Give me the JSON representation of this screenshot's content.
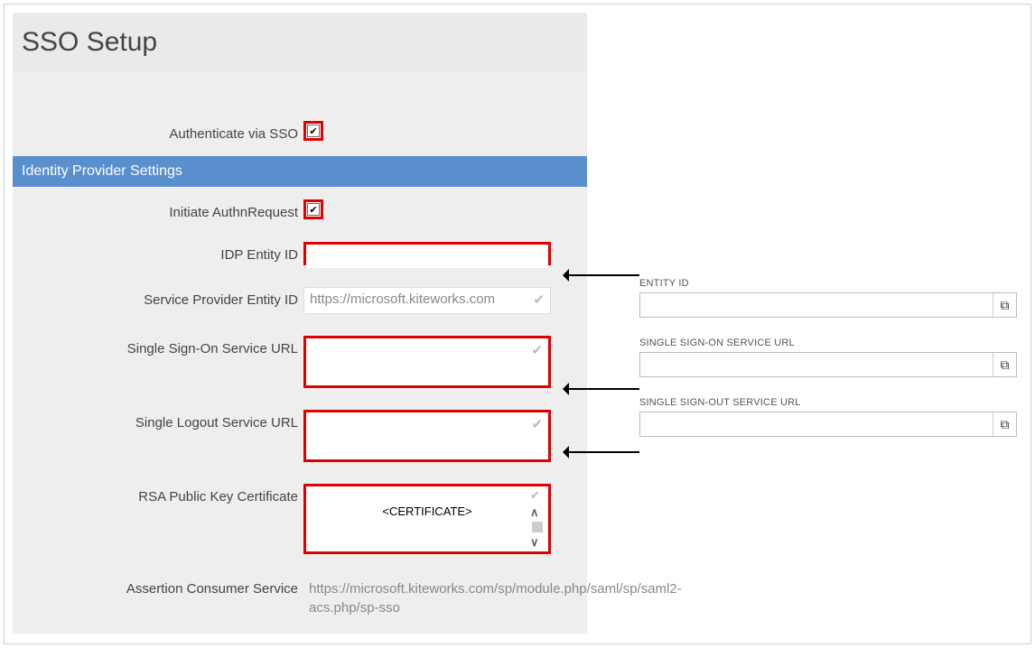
{
  "left": {
    "page_title": "SSO Setup",
    "auth_via_sso_label": "Authenticate via SSO",
    "auth_via_sso_checked": true,
    "section_header": "Identity Provider Settings",
    "initiate_label": "Initiate AuthnRequest",
    "initiate_checked": true,
    "idp_entity_id_label": "IDP Entity ID",
    "idp_entity_id_value": "",
    "sp_entity_id_label": "Service Provider Entity ID",
    "sp_entity_id_value": "https://microsoft.kiteworks.com",
    "sso_url_label": "Single Sign-On Service URL",
    "sso_url_value": "",
    "slo_url_label": "Single Logout Service URL",
    "slo_url_value": "",
    "rsa_cert_label": "RSA Public Key Certificate",
    "rsa_cert_placeholder": "<CERTIFICATE>",
    "acs_label": "Assertion Consumer Service",
    "acs_value": "https://microsoft.kiteworks.com/sp/module.php/saml/sp/saml2-acs.php/sp-sso"
  },
  "right": {
    "entity_id_label": "ENTITY ID",
    "entity_id_value": "",
    "sso_url_label": "SINGLE SIGN-ON SERVICE URL",
    "sso_url_value": "",
    "slo_url_label": "SINGLE SIGN-OUT SERVICE URL",
    "slo_url_value": ""
  }
}
